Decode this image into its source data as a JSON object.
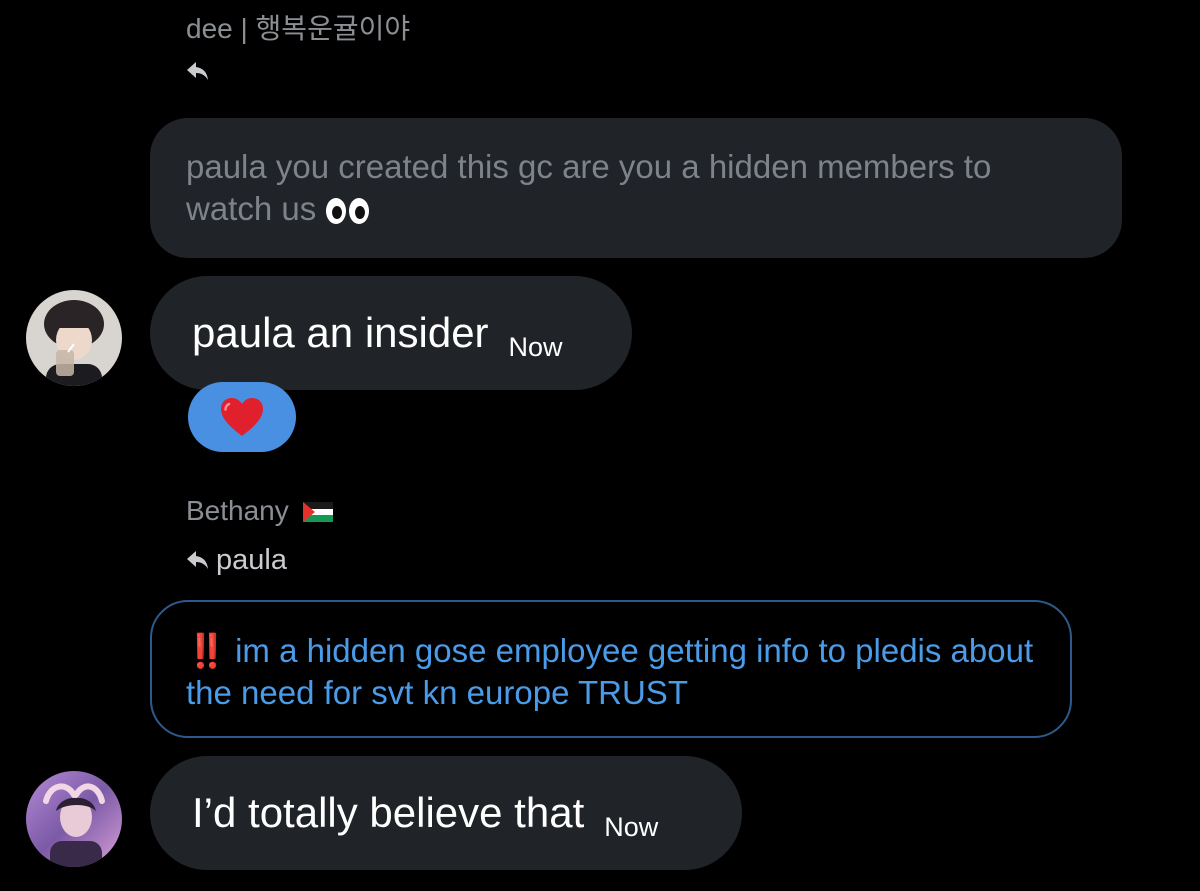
{
  "messages": [
    {
      "quote": {
        "sender": "dee | 행복운귤이야",
        "reply_to": "",
        "text": "paula you created this gc are you a hidden members to watch us",
        "emoji": "eyes"
      },
      "reply": {
        "text": "paula an insider",
        "time": "Now",
        "reaction": "heart",
        "avatar": "avatar-1"
      }
    },
    {
      "quote": {
        "sender": "Bethany",
        "sender_flag": "palestine-flag",
        "reply_to": "paula",
        "prefix": "‼️",
        "text": "im a hidden gose employee getting info to pledis about the need for svt kn europe TRUST"
      },
      "reply": {
        "text": "I’d totally believe that",
        "time": "Now",
        "avatar": "avatar-2"
      }
    }
  ],
  "colors": {
    "background": "#000000",
    "bubble": "#202327",
    "muted_text": "#7e8389",
    "accent_blue": "#4a9be8",
    "reaction_blue": "#4a90e2",
    "heart_red": "#e0202c"
  }
}
